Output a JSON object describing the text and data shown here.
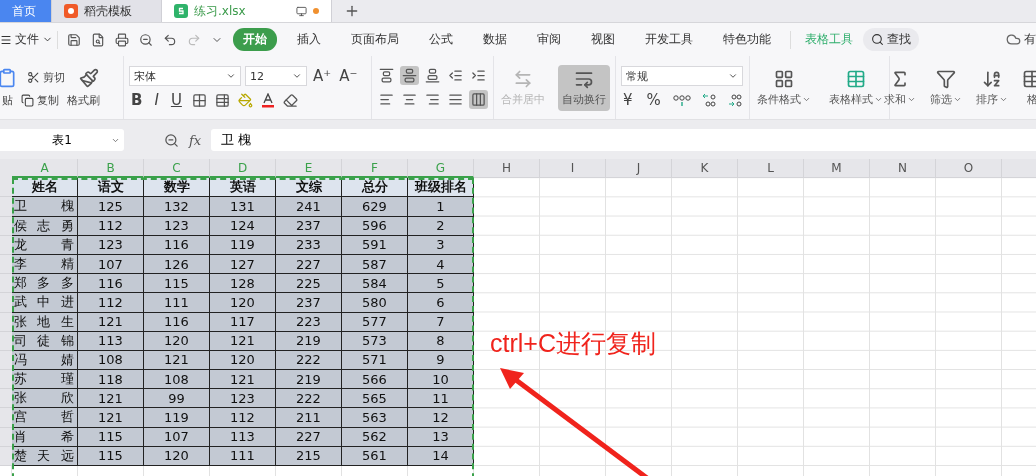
{
  "tabs": [
    {
      "label": "首页",
      "kind": "home",
      "selected": false
    },
    {
      "label": "稻壳模板",
      "kind": "app",
      "selected": false
    },
    {
      "label": "练习.xlsx",
      "kind": "sheet",
      "selected": true
    }
  ],
  "menu": {
    "file": "文件",
    "items": [
      {
        "label": "开始",
        "selected": true
      },
      {
        "label": "插入",
        "selected": false
      },
      {
        "label": "页面布局",
        "selected": false
      },
      {
        "label": "公式",
        "selected": false
      },
      {
        "label": "数据",
        "selected": false
      },
      {
        "label": "审阅",
        "selected": false
      },
      {
        "label": "视图",
        "selected": false
      },
      {
        "label": "开发工具",
        "selected": false
      },
      {
        "label": "特色功能",
        "selected": false
      }
    ],
    "context_tab": "表格工具",
    "search": "查找",
    "account": "有"
  },
  "ribbon": {
    "clipboard": [
      "贴",
      "剪切",
      "复制",
      "格式刷"
    ],
    "font": {
      "family": "宋体",
      "size": "12",
      "size_buttons": [
        "A⁺",
        "A⁻"
      ],
      "styles": [
        "B",
        "I",
        "U"
      ]
    },
    "align": [
      {
        "selected": false
      },
      {
        "selected": true
      },
      {
        "selected": false
      },
      {
        "selected": false
      },
      {
        "selected": false
      },
      {
        "selected": false
      },
      {
        "selected": false
      },
      {
        "selected": false
      },
      {
        "selected": false
      },
      {
        "selected": true
      }
    ],
    "merge": {
      "label": "合并居中",
      "disabled": true
    },
    "wrap": {
      "label": "自动换行",
      "selected": true
    },
    "number": {
      "format": "常规",
      "symbols": [
        "¥",
        "%"
      ]
    },
    "styles": [
      "条件格式",
      "表格样式"
    ],
    "tools": [
      "求和",
      "筛选",
      "排序",
      "格"
    ]
  },
  "formula_bar": {
    "name_box": "表1",
    "fx": "fx",
    "value": "卫 槐"
  },
  "columns": [
    {
      "label": "A",
      "selected": true
    },
    {
      "label": "B",
      "selected": true
    },
    {
      "label": "C",
      "selected": true
    },
    {
      "label": "D",
      "selected": true
    },
    {
      "label": "E",
      "selected": true
    },
    {
      "label": "F",
      "selected": true
    },
    {
      "label": "G",
      "selected": true
    },
    {
      "label": "H",
      "selected": false
    },
    {
      "label": "I",
      "selected": false
    },
    {
      "label": "J",
      "selected": false
    },
    {
      "label": "K",
      "selected": false
    },
    {
      "label": "L",
      "selected": false
    },
    {
      "label": "M",
      "selected": false
    },
    {
      "label": "N",
      "selected": false
    },
    {
      "label": "O",
      "selected": false
    }
  ],
  "table": {
    "header": [
      "姓名",
      "语文",
      "数学",
      "英语",
      "文综",
      "总分",
      "班级排名"
    ],
    "rows": [
      {
        "selected": true,
        "cells": [
          "卫 槐",
          "125",
          "132",
          "131",
          "241",
          "629",
          "1"
        ]
      },
      {
        "selected": true,
        "cells": [
          "侯 志 勇",
          "112",
          "123",
          "124",
          "237",
          "596",
          "2"
        ]
      },
      {
        "selected": true,
        "cells": [
          "龙 青",
          "123",
          "116",
          "119",
          "233",
          "591",
          "3"
        ]
      },
      {
        "selected": true,
        "cells": [
          "李 精",
          "107",
          "126",
          "127",
          "227",
          "587",
          "4"
        ]
      },
      {
        "selected": true,
        "cells": [
          "郑 多 多",
          "116",
          "115",
          "128",
          "225",
          "584",
          "5"
        ]
      },
      {
        "selected": true,
        "cells": [
          "武 中 进",
          "112",
          "111",
          "120",
          "237",
          "580",
          "6"
        ]
      },
      {
        "selected": true,
        "cells": [
          "张 地 生",
          "121",
          "116",
          "117",
          "223",
          "577",
          "7"
        ]
      },
      {
        "selected": true,
        "cells": [
          "司 徒 锦",
          "113",
          "120",
          "121",
          "219",
          "573",
          "8"
        ]
      },
      {
        "selected": true,
        "cells": [
          "冯 婧",
          "108",
          "121",
          "120",
          "222",
          "571",
          "9"
        ]
      },
      {
        "selected": true,
        "cells": [
          "苏 瑾",
          "118",
          "108",
          "121",
          "219",
          "566",
          "10"
        ]
      },
      {
        "selected": true,
        "cells": [
          "张 欣",
          "121",
          "99",
          "123",
          "222",
          "565",
          "11"
        ]
      },
      {
        "selected": true,
        "cells": [
          "宫 哲",
          "121",
          "119",
          "112",
          "211",
          "563",
          "12"
        ]
      },
      {
        "selected": true,
        "cells": [
          "肖 希",
          "115",
          "107",
          "113",
          "227",
          "562",
          "13"
        ]
      },
      {
        "selected": true,
        "cells": [
          "楚 天 远",
          "115",
          "120",
          "111",
          "215",
          "561",
          "14"
        ]
      }
    ]
  },
  "annotation": "ctrl+C进行复制"
}
